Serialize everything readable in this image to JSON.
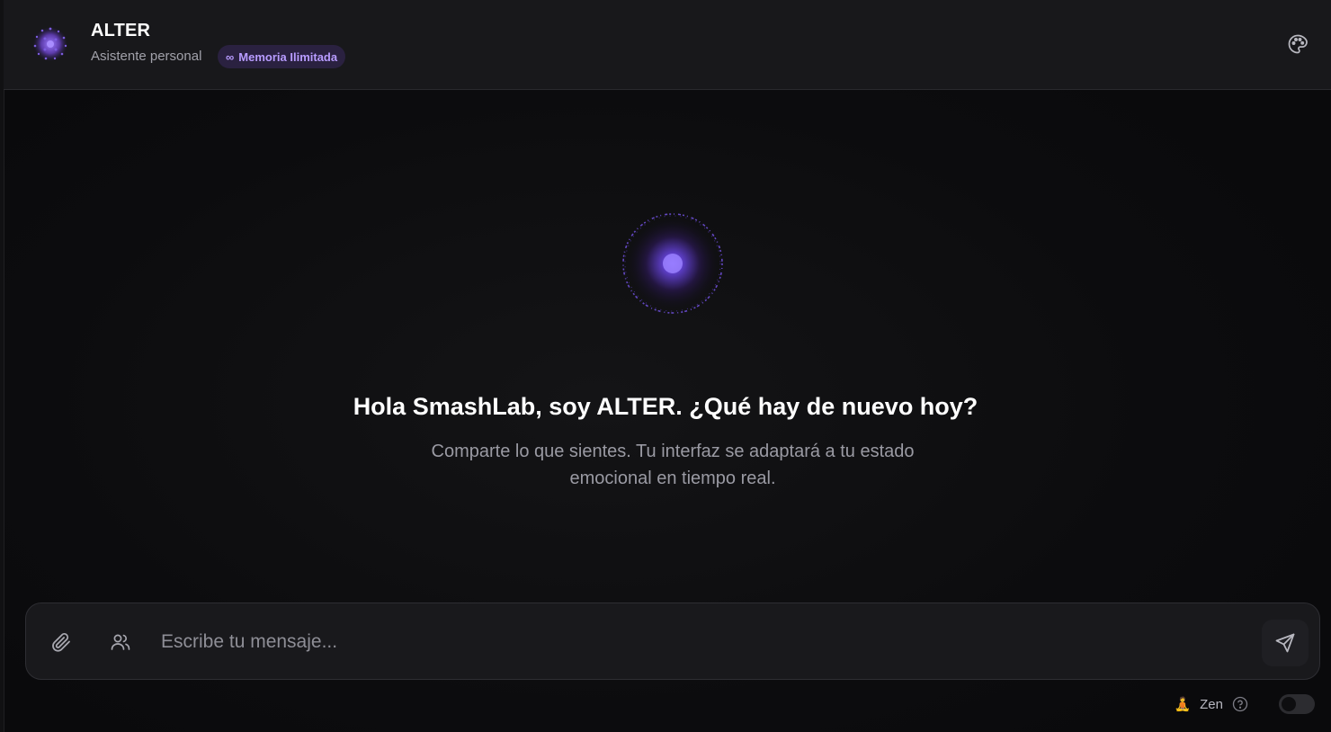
{
  "header": {
    "title": "ALTER",
    "subtitle": "Asistente personal",
    "memory_badge": {
      "symbol": "∞",
      "label": "Memoria Ilimitada"
    },
    "logo_icon": "purple-particle-sphere-icon",
    "palette_icon": "palette-icon"
  },
  "main": {
    "orb_icon": "glowing-orb-icon",
    "greeting": "Hola SmashLab, soy ALTER. ¿Qué hay de nuevo hoy?",
    "description": "Comparte lo que sientes. Tu interfaz se adaptará a tu estado emocional en tiempo real."
  },
  "composer": {
    "placeholder": "Escribe tu mensaje...",
    "value": "",
    "attach_icon": "paperclip-icon",
    "people_icon": "users-icon",
    "send_icon": "send-icon"
  },
  "footer": {
    "zen_emoji": "🧘",
    "zen_label": "Zen",
    "help_icon": "help-circle-icon",
    "zen_toggle_on": false
  },
  "colors": {
    "background": "#0d0d0f",
    "header_bg": "#18181b",
    "accent_purple": "#8b5cf6",
    "badge_bg": "#2a2140",
    "badge_text": "#b89cff"
  }
}
